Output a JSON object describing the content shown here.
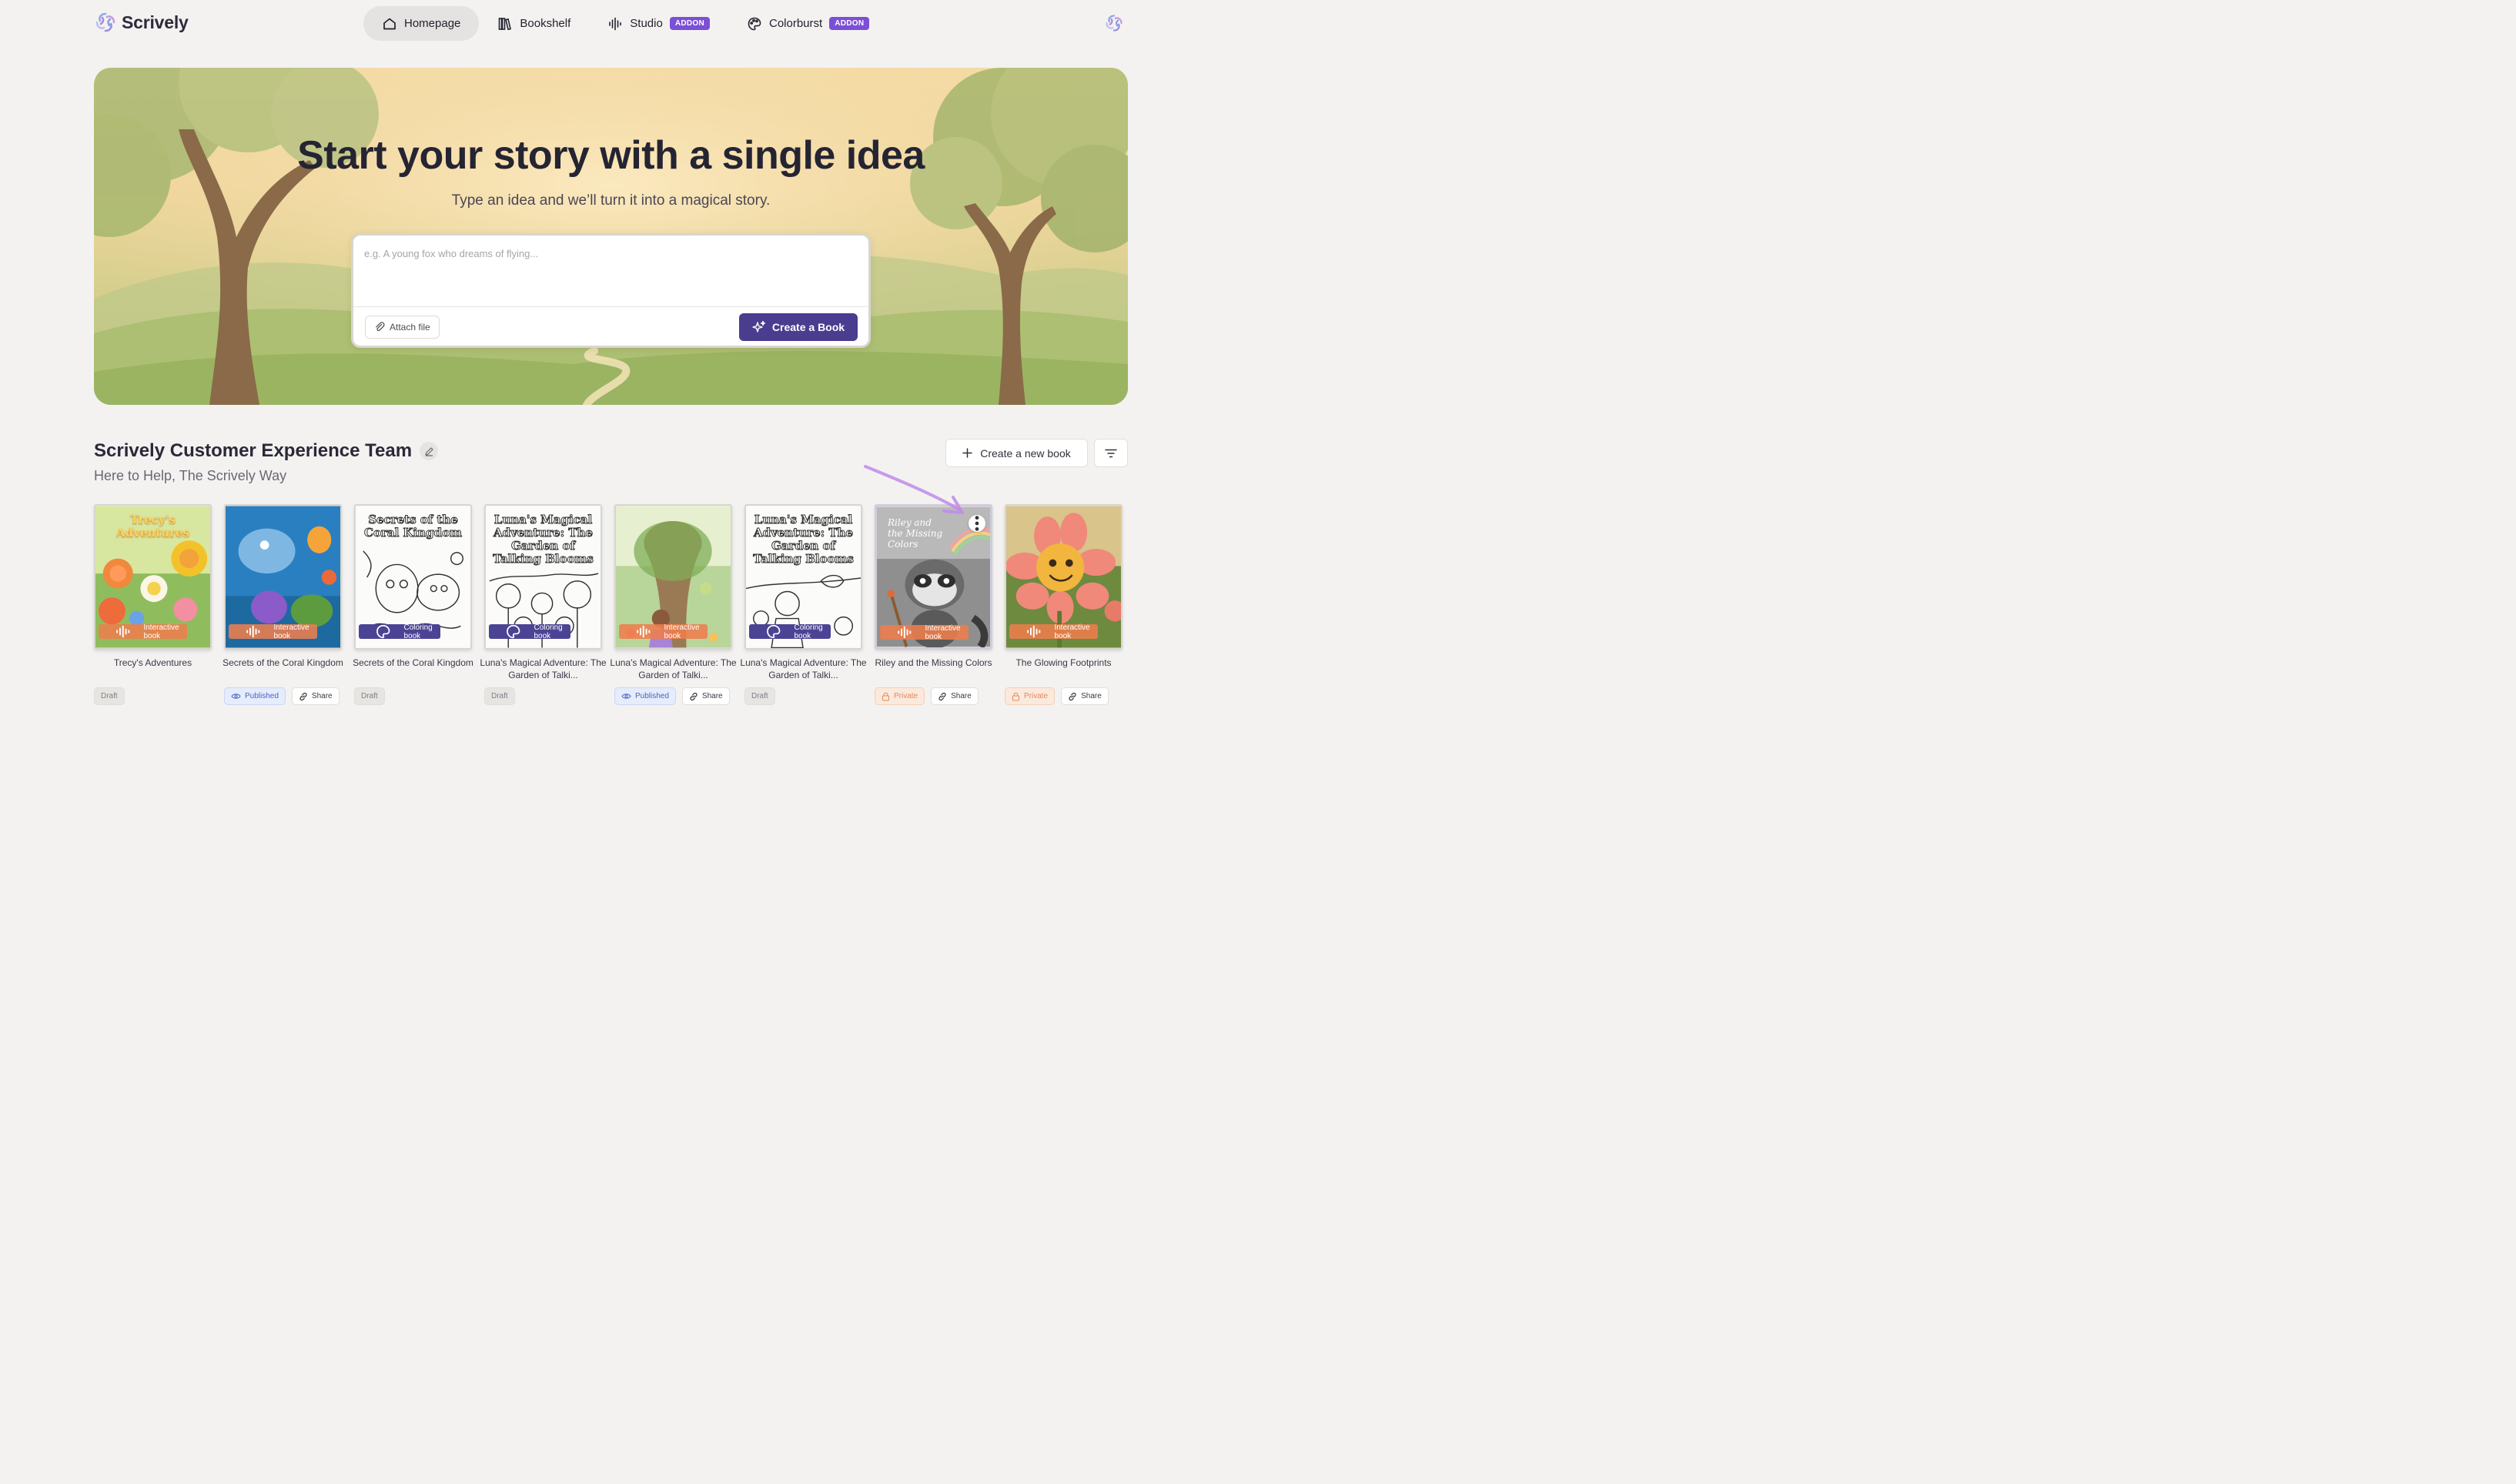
{
  "app": {
    "name": "Scrively"
  },
  "nav": {
    "items": [
      {
        "label": "Homepage",
        "icon": "home-icon",
        "active": true
      },
      {
        "label": "Bookshelf",
        "icon": "bookshelf-icon"
      },
      {
        "label": "Studio",
        "icon": "audio-waveform-icon",
        "badge": "ADDON"
      },
      {
        "label": "Colorburst",
        "icon": "palette-icon",
        "badge": "ADDON"
      }
    ]
  },
  "hero": {
    "title": "Start your story with a single idea",
    "subtitle": "Type an idea and we’ll turn it into a magical story.",
    "input_placeholder": "e.g. A young fox who dreams of flying...",
    "attach_label": "Attach file",
    "create_label": "Create a Book"
  },
  "section": {
    "title": "Scrively Customer Experience Team",
    "subtitle": "Here to Help, The Scrively Way",
    "new_book_label": "Create a new book"
  },
  "books": [
    {
      "name": "Trecy's Adventures",
      "cover_text": "Trecy's Adventures",
      "type": "Interactive book",
      "status": "Draft",
      "share": null
    },
    {
      "name": "Secrets of the Coral Kingdom",
      "cover_text": "",
      "type": "Interactive book",
      "status": "Published",
      "share": "Share"
    },
    {
      "name": "Secrets of the Coral Kingdom",
      "cover_text": "Secrets of the Coral Kingdom",
      "type": "Coloring book",
      "status": "Draft",
      "share": null
    },
    {
      "name": "Luna's Magical Adventure: The Garden of Talki...",
      "cover_text": "Luna's Magical Adventure: The Garden of Talking Blooms",
      "type": "Coloring book",
      "status": "Draft",
      "share": null
    },
    {
      "name": "Luna's Magical Adventure: The Garden of Talki...",
      "cover_text": "",
      "type": "Interactive book",
      "status": "Published",
      "share": "Share"
    },
    {
      "name": "Luna's Magical Adventure: The Garden of Talki...",
      "cover_text": "Luna's Magical Adventure: The Garden of Talking Blooms",
      "type": "Coloring book",
      "status": "Draft",
      "share": null
    },
    {
      "name": "Riley and the Missing Colors",
      "cover_text": "Riley and the Missing Colors",
      "type": "Interactive book",
      "status": "Private",
      "share": "Share"
    },
    {
      "name": "The Glowing Footprints",
      "cover_text": "",
      "type": "Interactive book",
      "status": "Private",
      "share": "Share"
    }
  ],
  "colors": {
    "accent": "#4a3d8f",
    "addon_badge": "#7b4fd6",
    "interactive_badge": "#ee7d4c",
    "coloring_badge": "#4b4394",
    "annotation_arrow": "#c08be8"
  }
}
